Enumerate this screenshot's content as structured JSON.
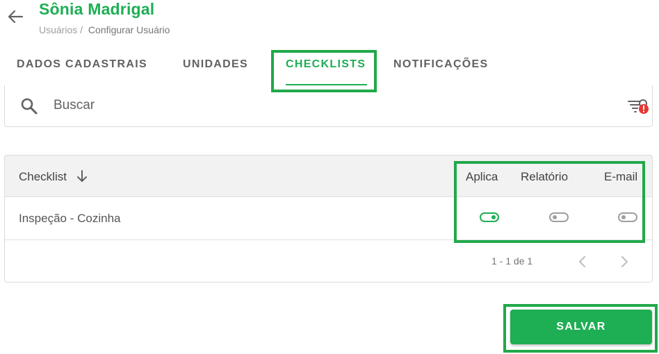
{
  "header": {
    "title": "Sônia Madrigal",
    "breadcrumb": [
      "Usuários /",
      "Configurar Usuário"
    ],
    "back_icon": "arrow-left-icon"
  },
  "tabs": [
    {
      "label": "DADOS CADASTRAIS",
      "active": false
    },
    {
      "label": "UNIDADES",
      "active": false
    },
    {
      "label": "CHECKLISTS",
      "active": true
    },
    {
      "label": "NOTIFICAÇÕES",
      "active": false
    }
  ],
  "search": {
    "placeholder": "Buscar",
    "value": "",
    "search_icon": "magnifier-icon",
    "filter_icon": "filter-alert-icon"
  },
  "table": {
    "columns": [
      "Checklist",
      "Aplica",
      "Relatório",
      "E-mail"
    ],
    "sort_icon": "arrow-down-icon",
    "rows": [
      {
        "checklist": "Inspeção - Cozinha",
        "aplica": true,
        "relatorio": false,
        "email": false
      }
    ]
  },
  "pagination": {
    "text": "1 - 1 de 1",
    "prev_icon": "chevron-left-icon",
    "next_icon": "chevron-right-icon"
  },
  "actions": {
    "save_label": "SALVAR"
  },
  "colors": {
    "accent": "#1eae54",
    "highlight_border": "#21a84a",
    "alert": "#e53935"
  }
}
